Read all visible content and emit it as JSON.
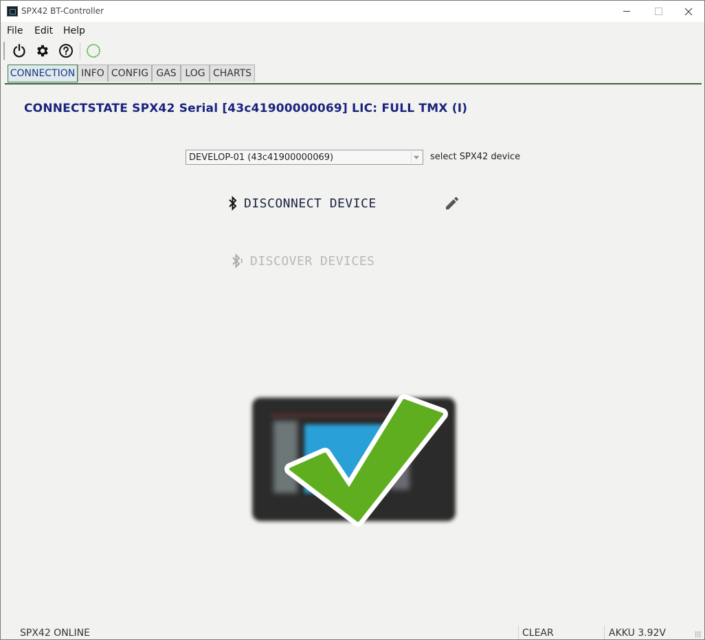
{
  "window": {
    "title": "SPX42 BT-Controller"
  },
  "menu": {
    "items": [
      "File",
      "Edit",
      "Help"
    ]
  },
  "toolbar": {
    "icons": [
      "power-icon",
      "settings-gear-icon",
      "help-icon",
      "online-status-ring-icon"
    ],
    "status_ring_color": "#5cb85c"
  },
  "tabs": [
    {
      "label": "CONNECTION",
      "active": true
    },
    {
      "label": "INFO"
    },
    {
      "label": "CONFIG"
    },
    {
      "label": "GAS"
    },
    {
      "label": "LOG"
    },
    {
      "label": "CHARTS"
    }
  ],
  "main": {
    "status_title": "CONNECTSTATE SPX42 Serial [43c41900000069] LIC: FULL TMX (I)",
    "device_select": {
      "value": "DEVELOP-01 (43c41900000069)",
      "label": "select SPX42 device"
    },
    "disconnect_label": "DISCONNECT DEVICE",
    "discover_label": "DISCOVER DEVICES",
    "accent_color": "#1a237e",
    "check_color": "#5fae1f"
  },
  "statusbar": {
    "online": "SPX42 ONLINE",
    "clear": "CLEAR",
    "akku": "AKKU 3.92V"
  }
}
